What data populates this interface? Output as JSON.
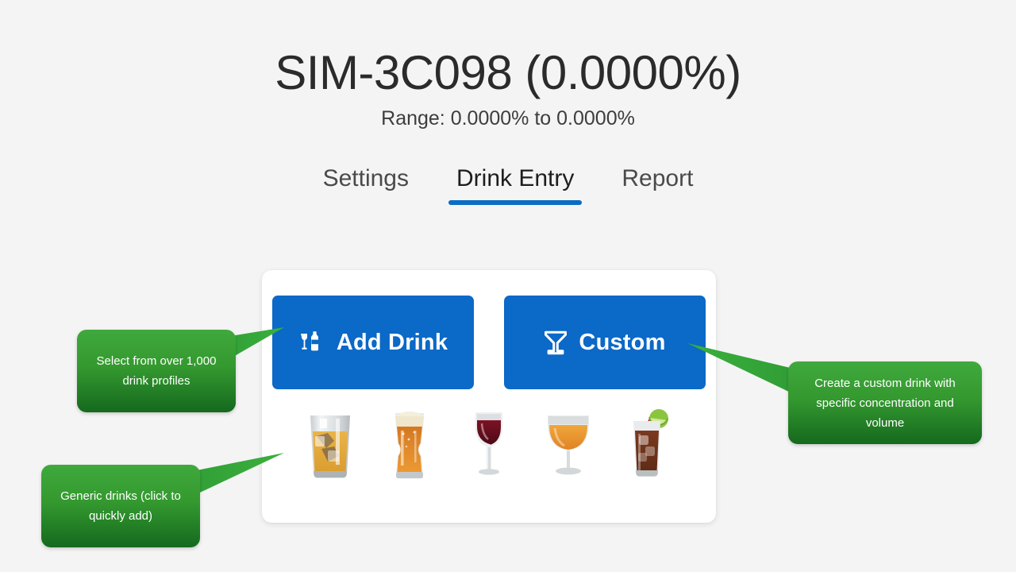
{
  "header": {
    "title": "SIM-3C098 (0.0000%)",
    "subtitle": "Range: 0.0000% to 0.0000%"
  },
  "tabs": [
    {
      "label": "Settings",
      "active": false
    },
    {
      "label": "Drink Entry",
      "active": true
    },
    {
      "label": "Report",
      "active": false
    }
  ],
  "card": {
    "buttons": [
      {
        "label": "Add Drink",
        "icon": "bottle-and-glass-icon"
      },
      {
        "label": "Custom",
        "icon": "cocktail-glass-icon"
      }
    ],
    "quick_drinks": [
      {
        "name": "whiskey-tumbler-icon"
      },
      {
        "name": "beer-glass-icon"
      },
      {
        "name": "wine-glass-icon"
      },
      {
        "name": "brandy-snifter-icon"
      },
      {
        "name": "cocktail-highball-icon"
      }
    ]
  },
  "callouts": [
    {
      "id": "add-drink",
      "text": "Select from over 1,000 drink profiles"
    },
    {
      "id": "custom",
      "text": "Create a custom drink with specific concentration and volume"
    },
    {
      "id": "generic",
      "text": "Generic drinks (click to quickly add)"
    }
  ],
  "colors": {
    "background": "#f4f4f4",
    "accent_blue": "#0b69c7",
    "tab_underline": "#0a6cc4",
    "callout_green_light": "#3fa93d",
    "callout_green_dark": "#15691e",
    "card_background": "#ffffff",
    "title_text": "#2b2b2b"
  }
}
